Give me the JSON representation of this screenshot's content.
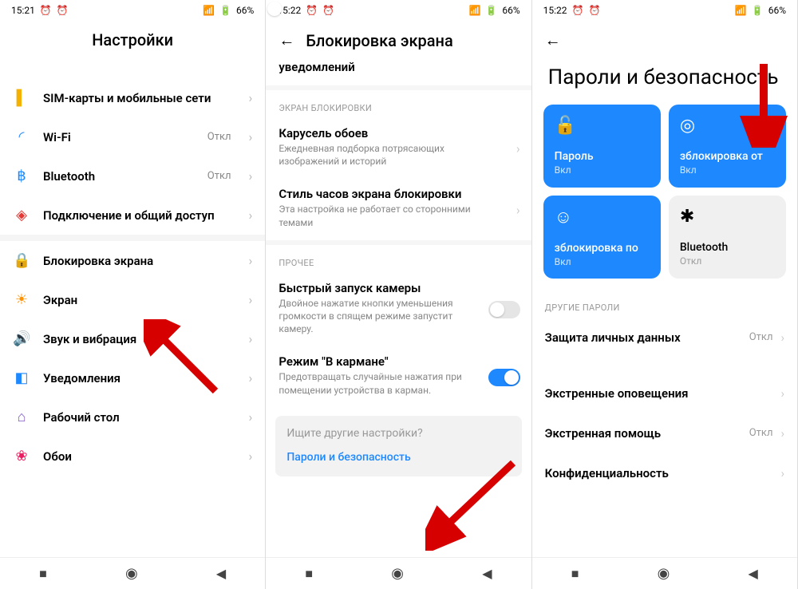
{
  "status": {
    "time1": "15:21",
    "time2": "15:22",
    "time3": "15:22",
    "battery": "66%"
  },
  "s1": {
    "title": "Настройки",
    "items": [
      {
        "icon": "▌",
        "iconClass": "ic-yellow",
        "label": "SIM-карты и мобильные сети",
        "val": ""
      },
      {
        "icon": "◜",
        "iconClass": "ic-blue",
        "label": "Wi-Fi",
        "val": "Откл"
      },
      {
        "icon": "฿",
        "iconClass": "ic-blue",
        "label": "Bluetooth",
        "val": "Откл"
      },
      {
        "icon": "◈",
        "iconClass": "ic-red",
        "label": "Подключение и общий доступ",
        "val": ""
      }
    ],
    "items2": [
      {
        "icon": "🔒",
        "iconClass": "ic-red",
        "label": "Блокировка экрана",
        "val": ""
      },
      {
        "icon": "☀",
        "iconClass": "ic-orange",
        "label": "Экран",
        "val": ""
      },
      {
        "icon": "🔊",
        "iconClass": "ic-green",
        "label": "Звук и вибрация",
        "val": ""
      },
      {
        "icon": "◧",
        "iconClass": "ic-blue",
        "label": "Уведомления",
        "val": ""
      },
      {
        "icon": "⌂",
        "iconClass": "ic-purple",
        "label": "Рабочий стол",
        "val": ""
      },
      {
        "icon": "❀",
        "iconClass": "ic-pink",
        "label": "Обои",
        "val": ""
      }
    ]
  },
  "s2": {
    "title": "Блокировка экрана",
    "partial_item": "уведомлений",
    "sec1": "ЭКРАН БЛОКИРОВКИ",
    "sec1items": [
      {
        "t": "Карусель обоев",
        "d": "Ежедневная подборка потрясающих изображений и историй",
        "chev": true
      },
      {
        "t": "Стиль часов экрана блокировки",
        "d": "Эта настройка не работает со сторонними темами",
        "chev": true
      }
    ],
    "sec2": "ПРОЧЕЕ",
    "sec2items": [
      {
        "t": "Быстрый запуск камеры",
        "d": "Двойное нажатие кнопки уменьшения громкости в спящем режиме запустит камеру.",
        "toggle": "off"
      },
      {
        "t": "Режим \"В кармане\"",
        "d": "Предотвращать случайные нажатия при помещении устройства в карман.",
        "toggle": "on"
      }
    ],
    "search_prompt": "Ищите другие настройки?",
    "search_link": "Пароли и безопасность"
  },
  "s3": {
    "title": "Пароли и безопасность",
    "tiles": [
      {
        "icon": "🔓",
        "label": "Пароль",
        "state": "Вкл",
        "style": "blue"
      },
      {
        "icon": "◎",
        "label": "зблокировка от",
        "state": "Вкл",
        "style": "blue"
      },
      {
        "icon": "☺",
        "label": "зблокировка по",
        "state": "Вкл",
        "style": "blue"
      },
      {
        "icon": "✱",
        "label": "Bluetooth",
        "state": "Откл",
        "style": "grey"
      }
    ],
    "sec": "ДРУГИЕ ПАРОЛИ",
    "rows": [
      {
        "label": "Защита личных данных",
        "val": "Откл"
      },
      {
        "label": "Экстренные оповещения",
        "val": ""
      },
      {
        "label": "Экстренная помощь",
        "val": "Откл"
      },
      {
        "label": "Конфиденциальность",
        "val": ""
      }
    ]
  }
}
